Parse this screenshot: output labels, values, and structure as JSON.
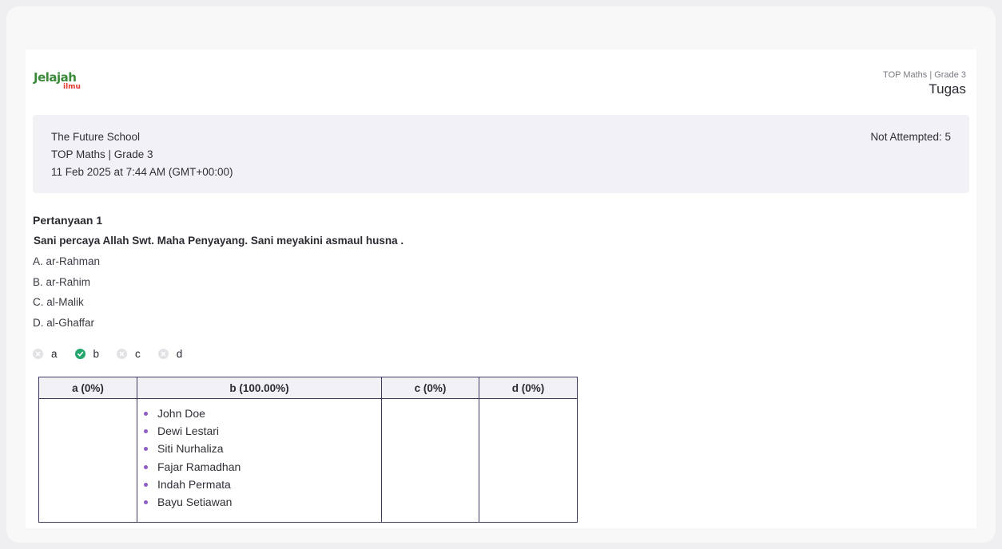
{
  "logo": {
    "line1": "Jelajah",
    "line2": "ilmu"
  },
  "header": {
    "course": "TOP Maths | Grade 3",
    "title": "Tugas"
  },
  "info": {
    "school": "The Future School",
    "course": "TOP Maths | Grade 3",
    "datetime": "11 Feb 2025 at 7:44 AM (GMT+00:00)",
    "not_attempted": "Not Attempted: 5"
  },
  "question": {
    "title": "Pertanyaan 1",
    "text": "Sani percaya Allah Swt. Maha Penyayang. Sani meyakini asmaul husna .",
    "options": [
      "A. ar-Rahman",
      "B. ar-Rahim",
      "C. al-Malik",
      "D. al-Ghaffar"
    ]
  },
  "answer_key": [
    {
      "label": "a",
      "status": "wrong-icon"
    },
    {
      "label": "b",
      "status": "check-icon"
    },
    {
      "label": "c",
      "status": "wrong-icon"
    },
    {
      "label": "d",
      "status": "wrong-icon"
    }
  ],
  "results_table": {
    "headers": [
      "a (0%)",
      "b (100.00%)",
      "c (0%)",
      "d (0%)"
    ],
    "b_students": [
      "John Doe",
      "Dewi Lestari",
      "Siti Nurhaliza",
      "Fajar Ramadhan",
      "Indah Permata",
      "Bayu Setiawan"
    ]
  },
  "colors": {
    "accent_purple": "#8e5cc4",
    "correct_green": "#24a66c",
    "table_border": "#3d3a60",
    "logo_green": "#3b8a3a",
    "logo_red": "#e23a2f"
  }
}
